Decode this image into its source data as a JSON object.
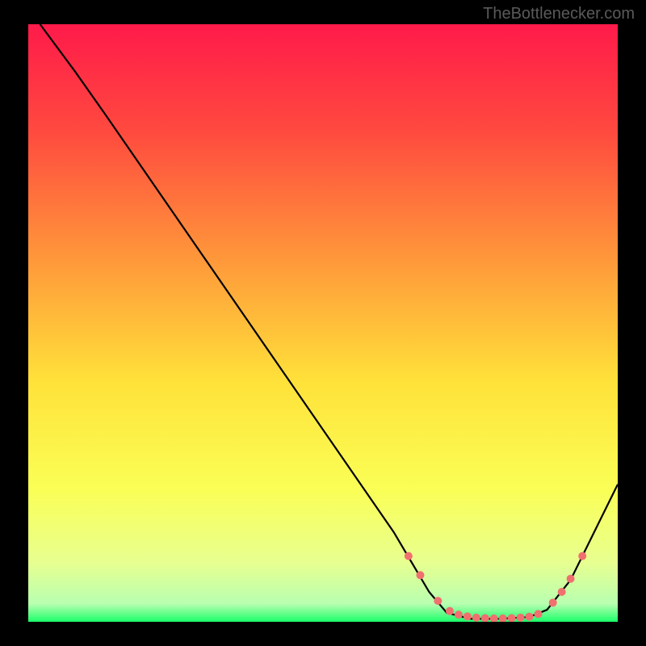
{
  "watermark": "TheBottlenecker.com",
  "chart_data": {
    "type": "line",
    "title": "",
    "xlabel": "",
    "ylabel": "",
    "xlim": [
      0,
      100
    ],
    "ylim": [
      0,
      100
    ],
    "background_gradient": {
      "stops": [
        {
          "offset": 0,
          "color": "#ff1a4a"
        },
        {
          "offset": 0.18,
          "color": "#ff4a3f"
        },
        {
          "offset": 0.4,
          "color": "#ff9a3a"
        },
        {
          "offset": 0.6,
          "color": "#ffe23a"
        },
        {
          "offset": 0.78,
          "color": "#faff56"
        },
        {
          "offset": 0.9,
          "color": "#e8ff90"
        },
        {
          "offset": 0.97,
          "color": "#b8ffb0"
        },
        {
          "offset": 1.0,
          "color": "#1aff6a"
        }
      ]
    },
    "series": [
      {
        "name": "curve",
        "color": "#000000",
        "points": [
          {
            "x": 2,
            "y": 100
          },
          {
            "x": 8,
            "y": 92
          },
          {
            "x": 13,
            "y": 85
          },
          {
            "x": 62,
            "y": 15
          },
          {
            "x": 68,
            "y": 5
          },
          {
            "x": 71,
            "y": 1.5
          },
          {
            "x": 75,
            "y": 0.5
          },
          {
            "x": 80,
            "y": 0.5
          },
          {
            "x": 85,
            "y": 0.8
          },
          {
            "x": 88,
            "y": 2
          },
          {
            "x": 92,
            "y": 7
          },
          {
            "x": 96,
            "y": 15
          },
          {
            "x": 100,
            "y": 23
          }
        ]
      }
    ],
    "markers": {
      "color": "#f07070",
      "radius": 5,
      "points": [
        {
          "x": 64.5,
          "y": 11
        },
        {
          "x": 66.5,
          "y": 7.8
        },
        {
          "x": 69.5,
          "y": 3.5
        },
        {
          "x": 71.5,
          "y": 1.8
        },
        {
          "x": 73,
          "y": 1.2
        },
        {
          "x": 74.5,
          "y": 0.9
        },
        {
          "x": 76,
          "y": 0.7
        },
        {
          "x": 77.5,
          "y": 0.6
        },
        {
          "x": 79,
          "y": 0.55
        },
        {
          "x": 80.5,
          "y": 0.55
        },
        {
          "x": 82,
          "y": 0.6
        },
        {
          "x": 83.5,
          "y": 0.7
        },
        {
          "x": 85,
          "y": 0.85
        },
        {
          "x": 86.5,
          "y": 1.3
        },
        {
          "x": 89,
          "y": 3.2
        },
        {
          "x": 90.5,
          "y": 5
        },
        {
          "x": 92,
          "y": 7.2
        },
        {
          "x": 94,
          "y": 11
        }
      ]
    }
  }
}
